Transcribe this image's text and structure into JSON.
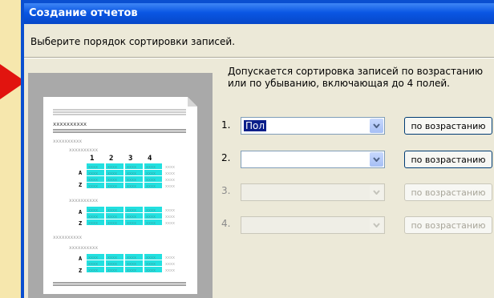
{
  "window": {
    "title": "Создание отчетов"
  },
  "instruction": "Выберите порядок сортировки записей.",
  "description": "Допускается сортировка записей по возрастанию\nили по убыванию, включающая до 4 полей.",
  "preview": {
    "placeholder": "xxxxxxxxxx",
    "cell": "xxxx",
    "column_numbers": [
      "1",
      "2",
      "3",
      "4"
    ],
    "sort_letters": [
      "A",
      "Z"
    ]
  },
  "sort_rows": [
    {
      "number": "1.",
      "value": "Пол",
      "order_label": "по возрастанию",
      "enabled": true
    },
    {
      "number": "2.",
      "value": "",
      "order_label": "по возрастанию",
      "enabled": true
    },
    {
      "number": "3.",
      "value": "",
      "order_label": "по возрастанию",
      "enabled": false
    },
    {
      "number": "4.",
      "value": "",
      "order_label": "по возрастанию",
      "enabled": false
    }
  ],
  "colors": {
    "titlebar": "#0a56e4",
    "highlight": "#22e0e0",
    "pointer": "#e1140f",
    "background": "#f6e7ad"
  }
}
